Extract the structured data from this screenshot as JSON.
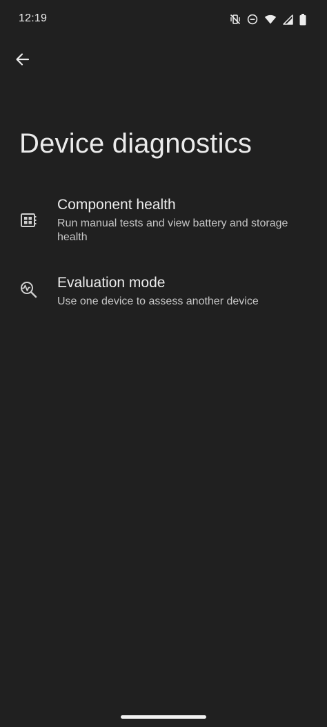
{
  "status_bar": {
    "time": "12:19",
    "icons": [
      "mute-vibrate-icon",
      "do-not-disturb-icon",
      "wifi-icon",
      "cell-signal-icon",
      "battery-icon"
    ]
  },
  "toolbar": {
    "back_icon": "arrow-back-icon"
  },
  "page": {
    "title": "Device diagnostics"
  },
  "items": [
    {
      "icon": "component-board-icon",
      "title": "Component health",
      "summary": "Run manual tests and view battery and storage health"
    },
    {
      "icon": "search-pulse-icon",
      "title": "Evaluation mode",
      "summary": "Use one device to assess another device"
    }
  ],
  "colors": {
    "background": "#202020",
    "text_primary": "#ececec",
    "text_secondary": "#c6c6c6"
  }
}
